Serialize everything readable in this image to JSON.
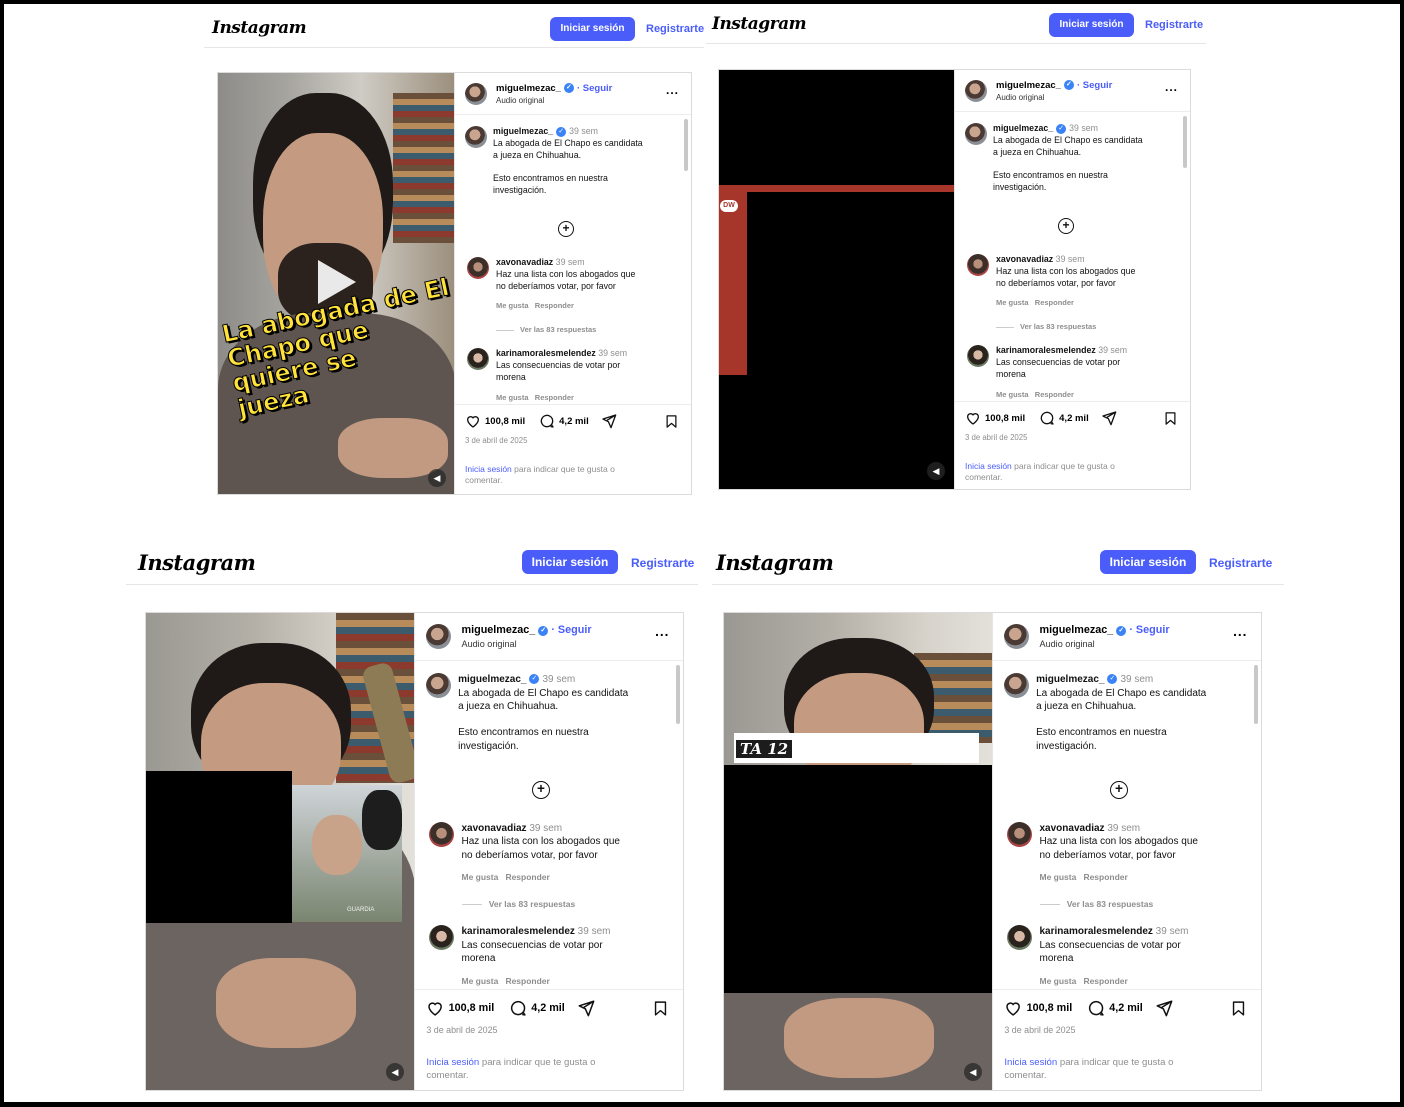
{
  "logo": "Instagram",
  "nav": {
    "login": "Iniciar sesión",
    "register": "Registrarte"
  },
  "post": {
    "username": "miguelmezac_",
    "follow": "Seguir",
    "audio": "Audio original",
    "more": "...",
    "caption_user": "miguelmezac_",
    "caption_time": "39 sem",
    "caption_line1": "La abogada de El Chapo es candidata",
    "caption_line2": "a jueza en Chihuahua.",
    "caption_line3": "Esto encontramos en nuestra",
    "caption_line4": "investigación.",
    "comment1_user": "xavonavadiaz",
    "comment1_time": "39 sem",
    "comment1_line1": "Haz una lista con los abogados que",
    "comment1_line2": "no deberíamos votar, por favor",
    "like": "Me gusta",
    "reply": "Responder",
    "view_replies": "Ver las 83 respuestas",
    "comment2_user": "karinamoralesmelendez",
    "comment2_time": "39 sem",
    "comment2_line1": "Las consecuencias de votar por",
    "comment2_line2": "morena",
    "likes": "100,8 mil",
    "comment_count": "4,2 mil",
    "date": "3 de abril de 2025",
    "login_link": "Inicia sesión",
    "login_rest1": "para indicar que te gusta o",
    "login_rest2": "comentar."
  },
  "video_caption": {
    "line1": "La abogada de El",
    "line2": "Chapo que quiere se",
    "line3": "jueza"
  },
  "overlays": {
    "dw_logo": "DW",
    "ta12": "TA 12",
    "watermark": "GUARDIA"
  },
  "icons": [
    "heart-icon",
    "comment-icon",
    "share-icon",
    "bookmark-icon",
    "add-circle-icon",
    "verified-icon",
    "mute-icon",
    "play-icon"
  ]
}
